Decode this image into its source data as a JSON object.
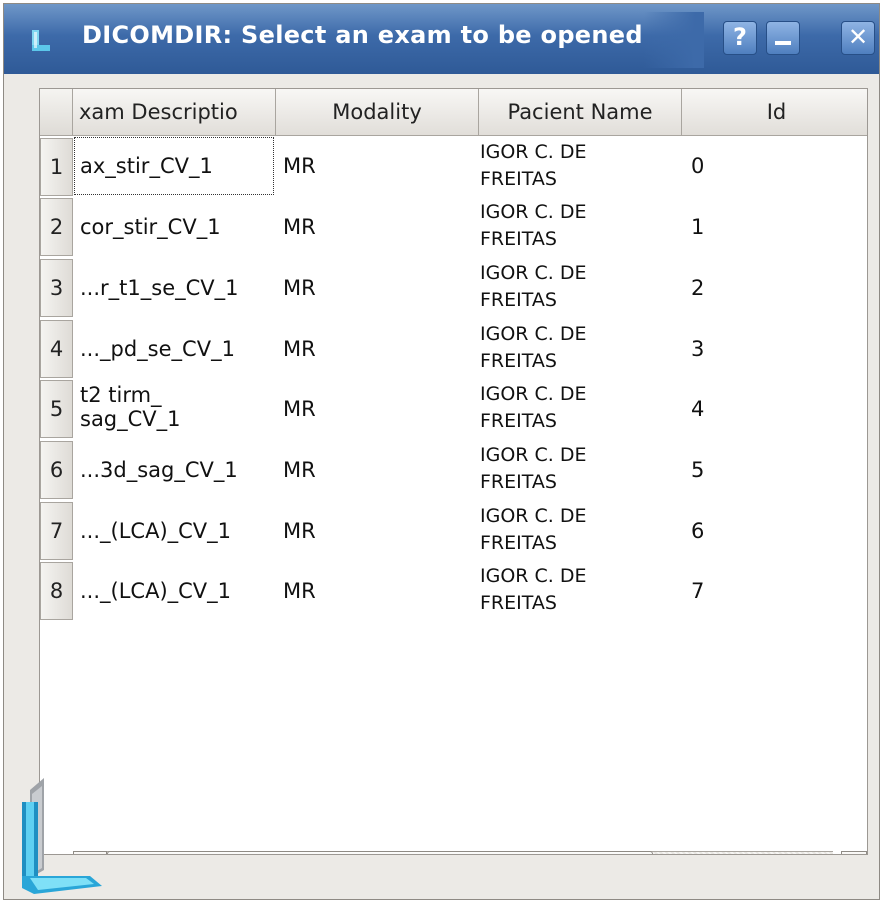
{
  "window": {
    "title": "DICOMDIR: Select an exam to be opened",
    "help_label": "?",
    "close_label": "✕"
  },
  "table": {
    "columns": [
      "xam Descriptio",
      "Modality",
      "Pacient Name",
      "Id"
    ],
    "rows": [
      {
        "num": "1",
        "desc": "ax_stir_CV_1",
        "modality": "MR",
        "name1": "IGOR C. DE",
        "name2": "FREITAS",
        "id": "0"
      },
      {
        "num": "2",
        "desc": "cor_stir_CV_1",
        "modality": "MR",
        "name1": "IGOR C. DE",
        "name2": "FREITAS",
        "id": "1"
      },
      {
        "num": "3",
        "desc": "...r_t1_se_CV_1",
        "modality": "MR",
        "name1": "IGOR C. DE",
        "name2": "FREITAS",
        "id": "2"
      },
      {
        "num": "4",
        "desc": "..._pd_se_CV_1",
        "modality": "MR",
        "name1": "IGOR C. DE",
        "name2": "FREITAS",
        "id": "3"
      },
      {
        "num": "5",
        "desc1": "t2 tirm_",
        "desc2": "sag_CV_1",
        "modality": "MR",
        "name1": "IGOR C. DE",
        "name2": "FREITAS",
        "id": "4"
      },
      {
        "num": "6",
        "desc": "...3d_sag_CV_1",
        "modality": "MR",
        "name1": "IGOR C. DE",
        "name2": "FREITAS",
        "id": "5"
      },
      {
        "num": "7",
        "desc": "..._(LCA)_CV_1",
        "modality": "MR",
        "name1": "IGOR C. DE",
        "name2": "FREITAS",
        "id": "6"
      },
      {
        "num": "8",
        "desc": "..._(LCA)_CV_1",
        "modality": "MR",
        "name1": "IGOR C. DE",
        "name2": "FREITAS",
        "id": "7"
      }
    ]
  },
  "scrollbar": {
    "left_arrow": "◀",
    "right_arrow": "▶"
  },
  "colors": {
    "titlebar": "#3d6aa9",
    "window_bg": "#eceae6",
    "logo_cyan": "#29a9d8"
  },
  "icons": [
    "app-icon",
    "help-icon",
    "minimize-icon",
    "close-icon",
    "app-logo"
  ]
}
